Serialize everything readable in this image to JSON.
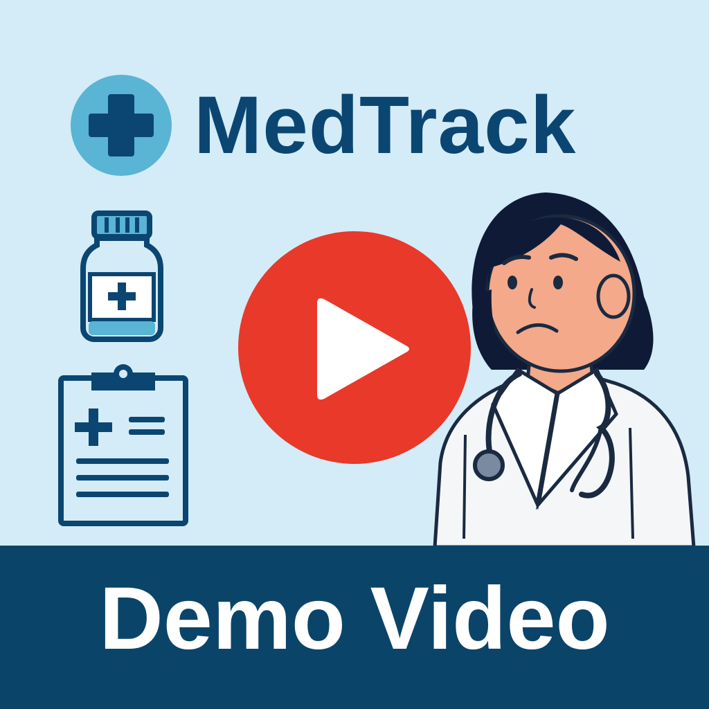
{
  "brand": {
    "name": "MedTrack",
    "logo_icon": "medical-cross-icon"
  },
  "video": {
    "play_icon": "play-icon"
  },
  "illustrations": {
    "bottle_icon": "medicine-bottle-icon",
    "clipboard_icon": "medical-clipboard-icon",
    "doctor_icon": "doctor-illustration"
  },
  "banner": {
    "label": "Demo Video"
  },
  "colors": {
    "background": "#d3ecf7",
    "brand_navy": "#0b4672",
    "accent_teal": "#5ab4d4",
    "play_red": "#e8392a",
    "banner_navy": "#0b4469"
  }
}
